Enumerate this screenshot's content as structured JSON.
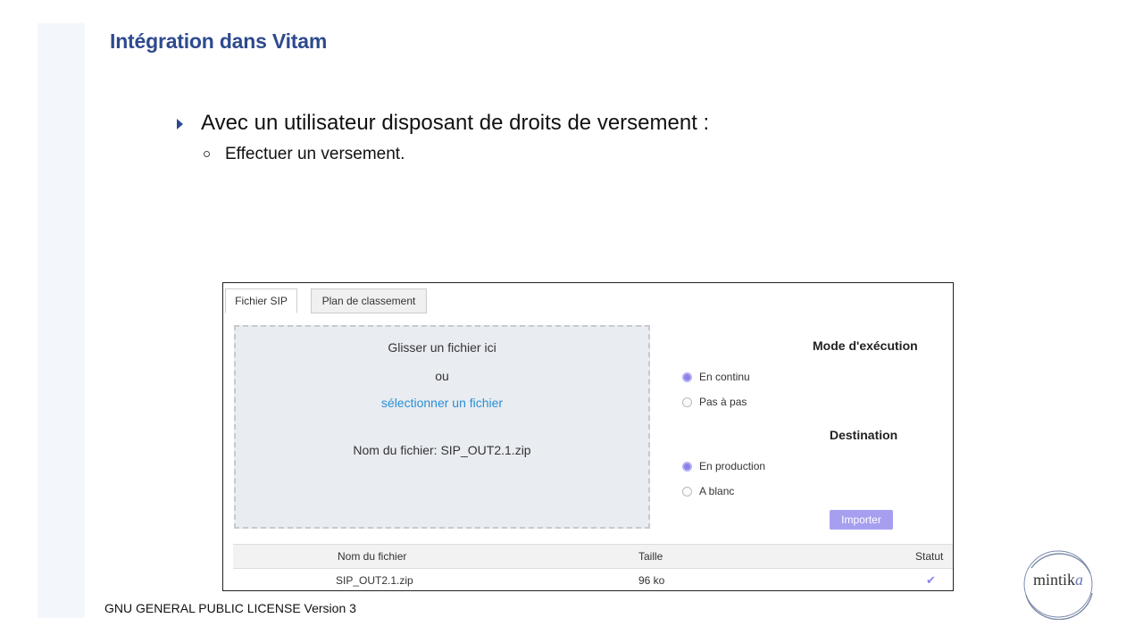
{
  "slide": {
    "title": "Intégration dans Vitam",
    "bullet_main": "Avec un utilisateur disposant de droits de versement :",
    "bullet_sub": "Effectuer un versement.",
    "footer": "GNU GENERAL PUBLIC LICENSE Version 3",
    "logo_text_main": "mintik",
    "logo_text_accent": "a"
  },
  "app": {
    "tabs": [
      "Fichier SIP",
      "Plan de classement"
    ],
    "active_tab": "Fichier SIP",
    "dropzone": {
      "drag_text": "Glisser un fichier ici",
      "or_text": "ou",
      "select_link": "sélectionner un fichier",
      "filename_text": "Nom du fichier: SIP_OUT2.1.zip"
    },
    "mode": {
      "heading": "Mode d'exécution",
      "options": [
        "En continu",
        "Pas à pas"
      ],
      "selected": "En continu"
    },
    "destination": {
      "heading": "Destination",
      "options": [
        "En production",
        "A blanc"
      ],
      "selected": "En production"
    },
    "import_button": "Importer",
    "table": {
      "headers": [
        "Nom du fichier",
        "Taille",
        "Statut"
      ],
      "rows": [
        {
          "name": "SIP_OUT2.1.zip",
          "size": "96 ko",
          "status": "check-icon"
        }
      ]
    },
    "colors": {
      "accent": "#8a82e8",
      "button": "#a69ff0",
      "link": "#2a8fd6",
      "title": "#2e4a8e"
    }
  }
}
